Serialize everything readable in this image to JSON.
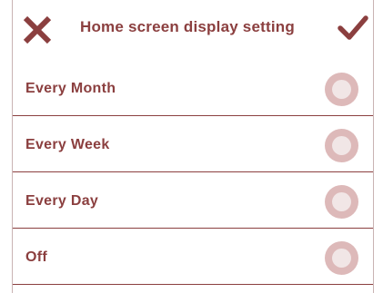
{
  "header": {
    "title": "Home screen display setting",
    "close_icon": "close-icon",
    "confirm_icon": "checkmark-icon"
  },
  "options": [
    {
      "label": "Every Month",
      "selected": false
    },
    {
      "label": "Every Week",
      "selected": false
    },
    {
      "label": "Every Day",
      "selected": false
    },
    {
      "label": "Off",
      "selected": false
    }
  ],
  "colors": {
    "accent": "#8b3f3f",
    "radio_outer": "#ddb9b9",
    "radio_inner": "#f1e6e6",
    "border": "#c9b3b3"
  }
}
